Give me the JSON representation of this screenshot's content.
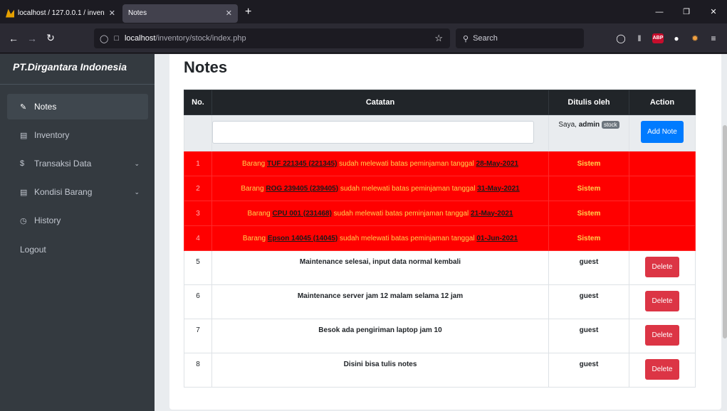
{
  "browser": {
    "tabs": [
      {
        "title": "localhost / 127.0.0.1 / inventory",
        "close": "✕"
      },
      {
        "title": "Notes",
        "close": "✕"
      }
    ],
    "new_tab": "+",
    "url_host": "localhost",
    "url_path": "/inventory/stock/index.php",
    "search_placeholder": "Search",
    "abp_label": "ABP"
  },
  "sidebar": {
    "brand": "PT.Dirgantara Indonesia",
    "items": [
      {
        "label": "Notes",
        "icon": "edit-icon",
        "active": true
      },
      {
        "label": "Inventory",
        "icon": "box-icon"
      },
      {
        "label": "Transaksi Data",
        "icon": "dollar-icon",
        "has_sub": true
      },
      {
        "label": "Kondisi Barang",
        "icon": "list-icon",
        "has_sub": true
      },
      {
        "label": "History",
        "icon": "clock-icon"
      }
    ],
    "logout": "Logout"
  },
  "main": {
    "title": "Notes",
    "table": {
      "headers": [
        "No.",
        "Catatan",
        "Ditulis oleh",
        "Action"
      ],
      "input_row": {
        "author_prefix": "Saya, ",
        "author_name": "admin",
        "badge": "stock",
        "add_button": "Add Note"
      },
      "alert_rows": [
        {
          "no": "1",
          "pre": "Barang ",
          "item": "TUF 221345 (221345)",
          "mid": " sudah melewati batas peminjaman tanggal ",
          "date": "28-May-2021",
          "by": "Sistem"
        },
        {
          "no": "2",
          "pre": "Barang ",
          "item": "ROG 239405 (239405)",
          "mid": " sudah melewati batas peminjaman tanggal ",
          "date": "31-May-2021",
          "by": "Sistem"
        },
        {
          "no": "3",
          "pre": "Barang ",
          "item": "CPU 001 (231468)",
          "mid": " sudah melewati batas peminjaman tanggal ",
          "date": "21-May-2021",
          "by": "Sistem"
        },
        {
          "no": "4",
          "pre": "Barang ",
          "item": "Epson 14045 (14045)",
          "mid": " sudah melewati batas peminjaman tanggal ",
          "date": "01-Jun-2021",
          "by": "Sistem"
        }
      ],
      "note_rows": [
        {
          "no": "5",
          "note": "Maintenance selesai, input data normal kembali",
          "by": "guest",
          "action": "Delete"
        },
        {
          "no": "6",
          "note": "Maintenance server jam 12 malam selama 12 jam",
          "by": "guest",
          "action": "Delete"
        },
        {
          "no": "7",
          "note": "Besok ada pengiriman laptop jam 10",
          "by": "guest",
          "action": "Delete"
        },
        {
          "no": "8",
          "note": "Disini bisa tulis notes",
          "by": "guest",
          "action": "Delete"
        }
      ]
    }
  }
}
